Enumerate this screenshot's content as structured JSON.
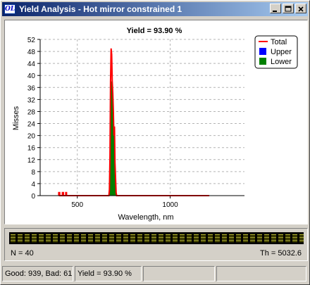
{
  "window": {
    "title": "Yield Analysis - Hot mirror constrained 1",
    "app_icon_text": "OL"
  },
  "chart_data": {
    "type": "bar",
    "title": "Yield = 93.90 %",
    "xlabel": "Wavelength, nm",
    "ylabel": "Misses",
    "xlim": [
      300,
      1400
    ],
    "ylim": [
      0,
      52
    ],
    "xticks": [
      500,
      1000
    ],
    "yticks": [
      0,
      4,
      8,
      12,
      16,
      20,
      24,
      28,
      32,
      36,
      40,
      44,
      48,
      52
    ],
    "grid": true,
    "legend_position": "top-right",
    "series": [
      {
        "name": "Total",
        "color": "#ff0000",
        "style": "line",
        "points": [
          [
            400,
            0
          ],
          [
            400,
            1
          ],
          [
            405,
            1
          ],
          [
            405,
            0
          ],
          [
            420,
            0
          ],
          [
            420,
            1
          ],
          [
            425,
            1
          ],
          [
            425,
            0
          ],
          [
            438,
            0
          ],
          [
            438,
            1
          ],
          [
            442,
            1
          ],
          [
            442,
            0
          ],
          [
            670,
            0
          ],
          [
            673,
            2
          ],
          [
            676,
            13
          ],
          [
            679,
            38
          ],
          [
            682,
            49
          ],
          [
            685,
            47
          ],
          [
            688,
            38
          ],
          [
            691,
            34
          ],
          [
            694,
            28
          ],
          [
            697,
            20
          ],
          [
            700,
            23
          ],
          [
            703,
            11
          ],
          [
            706,
            6
          ],
          [
            709,
            1
          ],
          [
            712,
            0
          ],
          [
            1210,
            0
          ]
        ]
      },
      {
        "name": "Upper",
        "color": "#0000ff",
        "style": "bar",
        "x": [],
        "values": []
      },
      {
        "name": "Lower",
        "color": "#008000",
        "style": "bar",
        "x": [
          676,
          679,
          682,
          685,
          688,
          691,
          694,
          697,
          700,
          703,
          706
        ],
        "values": [
          13,
          38,
          38,
          38,
          36,
          34,
          28,
          20,
          23,
          11,
          6
        ]
      }
    ]
  },
  "panel": {
    "n_label": "N = 40",
    "th_label": "Th = 5032.6"
  },
  "status": {
    "good_bad": "Good: 939, Bad: 61",
    "yield": "Yield = 93.90 %"
  }
}
